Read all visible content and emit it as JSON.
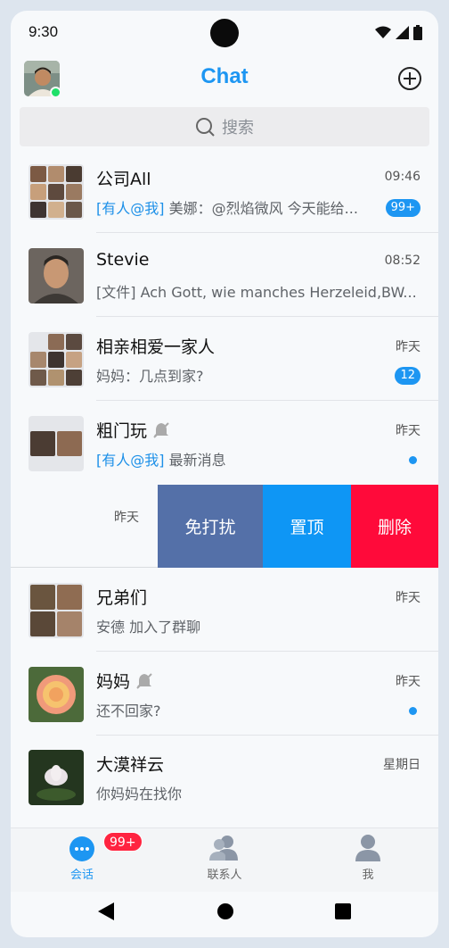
{
  "status": {
    "time": "9:30"
  },
  "header": {
    "title": "Chat"
  },
  "search": {
    "placeholder": "搜索"
  },
  "chats": [
    {
      "name": "公司All",
      "time": "09:46",
      "mention": "[有人@我]",
      "preview": " 美娜：@烈焰微风 今天能给...",
      "badge": "99+"
    },
    {
      "name": "Stevie",
      "time": "08:52",
      "preview": "[文件] Ach Gott, wie manches Herzeleid,BW..."
    },
    {
      "name": "相亲相爱一家人",
      "time": "昨天",
      "preview": "妈妈：几点到家?",
      "badge": "12"
    },
    {
      "name": "粗门玩",
      "time": "昨天",
      "mention": "[有人@我]",
      "preview": " 最新消息",
      "muted": true,
      "unread_dot": true
    },
    {
      "name": "兄弟们",
      "time": "昨天",
      "preview": "安德 加入了群聊"
    },
    {
      "name": "妈妈",
      "time": "昨天",
      "preview": "还不回家?",
      "muted": true,
      "unread_dot": true
    },
    {
      "name": "大漠祥云",
      "time": "星期日",
      "preview": "你妈妈在找你"
    }
  ],
  "swipe": {
    "time": "昨天",
    "mute_label": "免打扰",
    "pin_label": "置顶",
    "delete_label": "删除"
  },
  "tabs": [
    {
      "label": "会话",
      "badge": "99+",
      "icon": "chat-bubble-icon",
      "active": true
    },
    {
      "label": "联系人",
      "icon": "contacts-icon"
    },
    {
      "label": "我",
      "icon": "person-icon"
    }
  ],
  "colors": {
    "accent": "#1d96f2",
    "mute": "#5470a8",
    "pin": "#0e96f5",
    "delete": "#ff0a3a",
    "badge_red": "#ff2440",
    "online": "#1fe06a"
  }
}
